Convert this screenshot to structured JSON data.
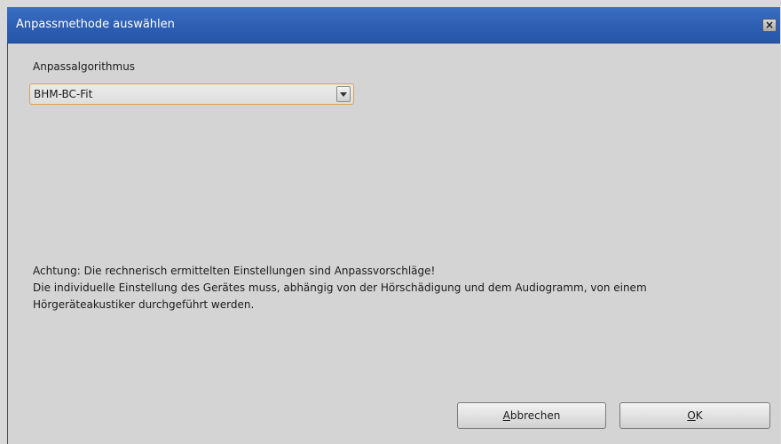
{
  "window": {
    "title": "Anpassmethode auswählen",
    "close_glyph": "×"
  },
  "form": {
    "algorithm_label": "Anpassalgorithmus",
    "algorithm_selected": "BHM-BC-Fit"
  },
  "notice": {
    "line1": "Achtung: Die rechnerisch ermittelten Einstellungen sind Anpassvorschläge!",
    "line2": "Die individuelle Einstellung des Gerätes muss, abhängig von der Hörschädigung und dem Audiogramm, von einem",
    "line3": "Hörgeräteakustiker durchgeführt werden."
  },
  "buttons": {
    "cancel_mnemonic": "A",
    "cancel_rest": "bbrechen",
    "ok_mnemonic": "O",
    "ok_rest": "K"
  },
  "colors": {
    "titlebar": "#2e5fb3",
    "background": "#d4d4d4",
    "select_focus_border": "#d8a060"
  }
}
